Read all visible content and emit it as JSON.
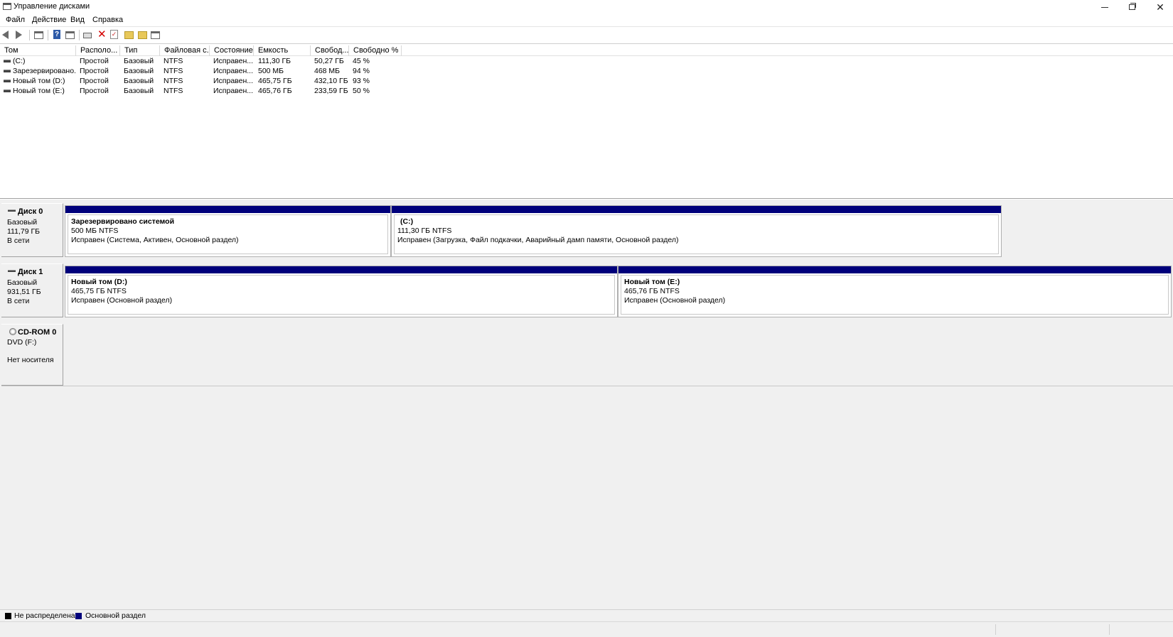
{
  "window": {
    "title": "Управление дисками"
  },
  "menu": [
    "Файл",
    "Действие",
    "Вид",
    "Справка"
  ],
  "toolbar": {
    "icons": [
      "back-arrow-icon",
      "forward-arrow-icon",
      "console-tree-icon",
      "help-icon",
      "properties-icon",
      "connect-icon",
      "delete-icon",
      "check-icon",
      "open-folder-icon",
      "explore-folder-icon",
      "list-view-icon"
    ]
  },
  "volume_list": {
    "columns": [
      "Том",
      "Располо...",
      "Тип",
      "Файловая с...",
      "Состояние",
      "Емкость",
      "Свобод...",
      "Свободно %"
    ],
    "rows": [
      [
        "(C:)",
        "Простой",
        "Базовый",
        "NTFS",
        "Исправен...",
        "111,30 ГБ",
        "50,27 ГБ",
        "45 %"
      ],
      [
        "Зарезервировано...",
        "Простой",
        "Базовый",
        "NTFS",
        "Исправен...",
        "500 МБ",
        "468 МБ",
        "94 %"
      ],
      [
        "Новый том (D:)",
        "Простой",
        "Базовый",
        "NTFS",
        "Исправен...",
        "465,75 ГБ",
        "432,10 ГБ",
        "93 %"
      ],
      [
        "Новый том (E:)",
        "Простой",
        "Базовый",
        "NTFS",
        "Исправен...",
        "465,76 ГБ",
        "233,59 ГБ",
        "50 %"
      ]
    ]
  },
  "disks": [
    {
      "name": "Диск 0",
      "type": "Базовый",
      "size": "111,79 ГБ",
      "status": "В сети",
      "partitions": [
        {
          "name": "Зарезервировано системой",
          "size": "500 МБ NTFS",
          "status": "Исправен (Система, Активен, Основной раздел)"
        },
        {
          "name": "(C:)",
          "size": "111,30 ГБ NTFS",
          "status": "Исправен (Загрузка, Файл подкачки, Аварийный дамп памяти, Основной раздел)"
        }
      ]
    },
    {
      "name": "Диск 1",
      "type": "Базовый",
      "size": "931,51 ГБ",
      "status": "В сети",
      "partitions": [
        {
          "name": "Новый том  (D:)",
          "size": "465,75 ГБ NTFS",
          "status": "Исправен (Основной раздел)"
        },
        {
          "name": "Новый том  (E:)",
          "size": "465,76 ГБ NTFS",
          "status": "Исправен (Основной раздел)"
        }
      ]
    }
  ],
  "cdrom": {
    "name": "CD-ROM 0",
    "drive": "DVD (F:)",
    "status": "Нет носителя"
  },
  "legend": [
    {
      "label": "Не распределена",
      "color": "#000000"
    },
    {
      "label": "Основной раздел",
      "color": "#00007b"
    }
  ],
  "colors": {
    "partition_bar": "#00007b",
    "background": "#f0f0f0"
  }
}
